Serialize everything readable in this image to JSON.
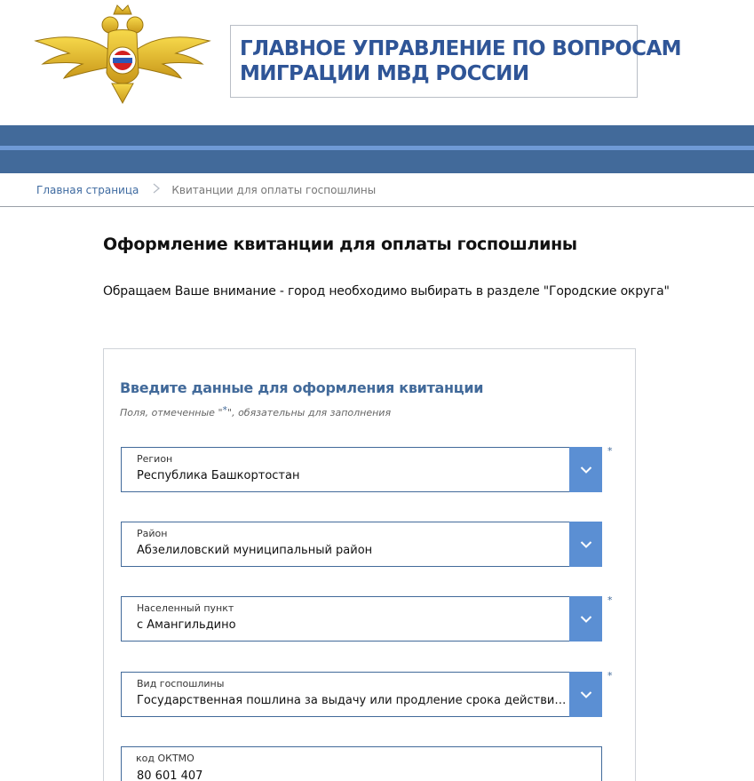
{
  "header": {
    "title_line1": "ГЛАВНОЕ УПРАВЛЕНИЕ ПО ВОПРОСАМ",
    "title_line2": "МИГРАЦИИ МВД РОССИИ",
    "emblem_icon": "double-headed-eagle-emblem-icon",
    "brand_color": "#426a9a",
    "accent_color": "#6f9ad6"
  },
  "breadcrumb": {
    "home": "Главная страница",
    "separator_icon": "chevron-right-icon",
    "current": "Квитанции для оплаты госпошлины"
  },
  "main": {
    "title": "Оформление квитанции для оплаты госпошлины",
    "notice": "Обращаем Ваше внимание -  город необходимо выбирать в разделе \"Городские округа\""
  },
  "form": {
    "heading": "Введите данные для оформления квитанции",
    "hint_before": "Поля, отмеченные \"",
    "hint_star": "*",
    "hint_after": "\", обязательны для заполнения",
    "required_mark": "*",
    "fields": [
      {
        "label": "Регион",
        "value": "Республика Башкортостан",
        "required": true
      },
      {
        "label": "Район",
        "value": "Абзелиловский муниципальный район",
        "required": false
      },
      {
        "label": "Населенный пункт",
        "value": "с Амангильдино",
        "required": true
      },
      {
        "label": "Вид госпошлины",
        "value": "Государственная пошлина за выдачу или продление срока действия вида на жительство иностранному гражданину",
        "required": true
      }
    ],
    "oktmo": {
      "label": "код ОКТМО",
      "value": "80 601 407"
    }
  }
}
